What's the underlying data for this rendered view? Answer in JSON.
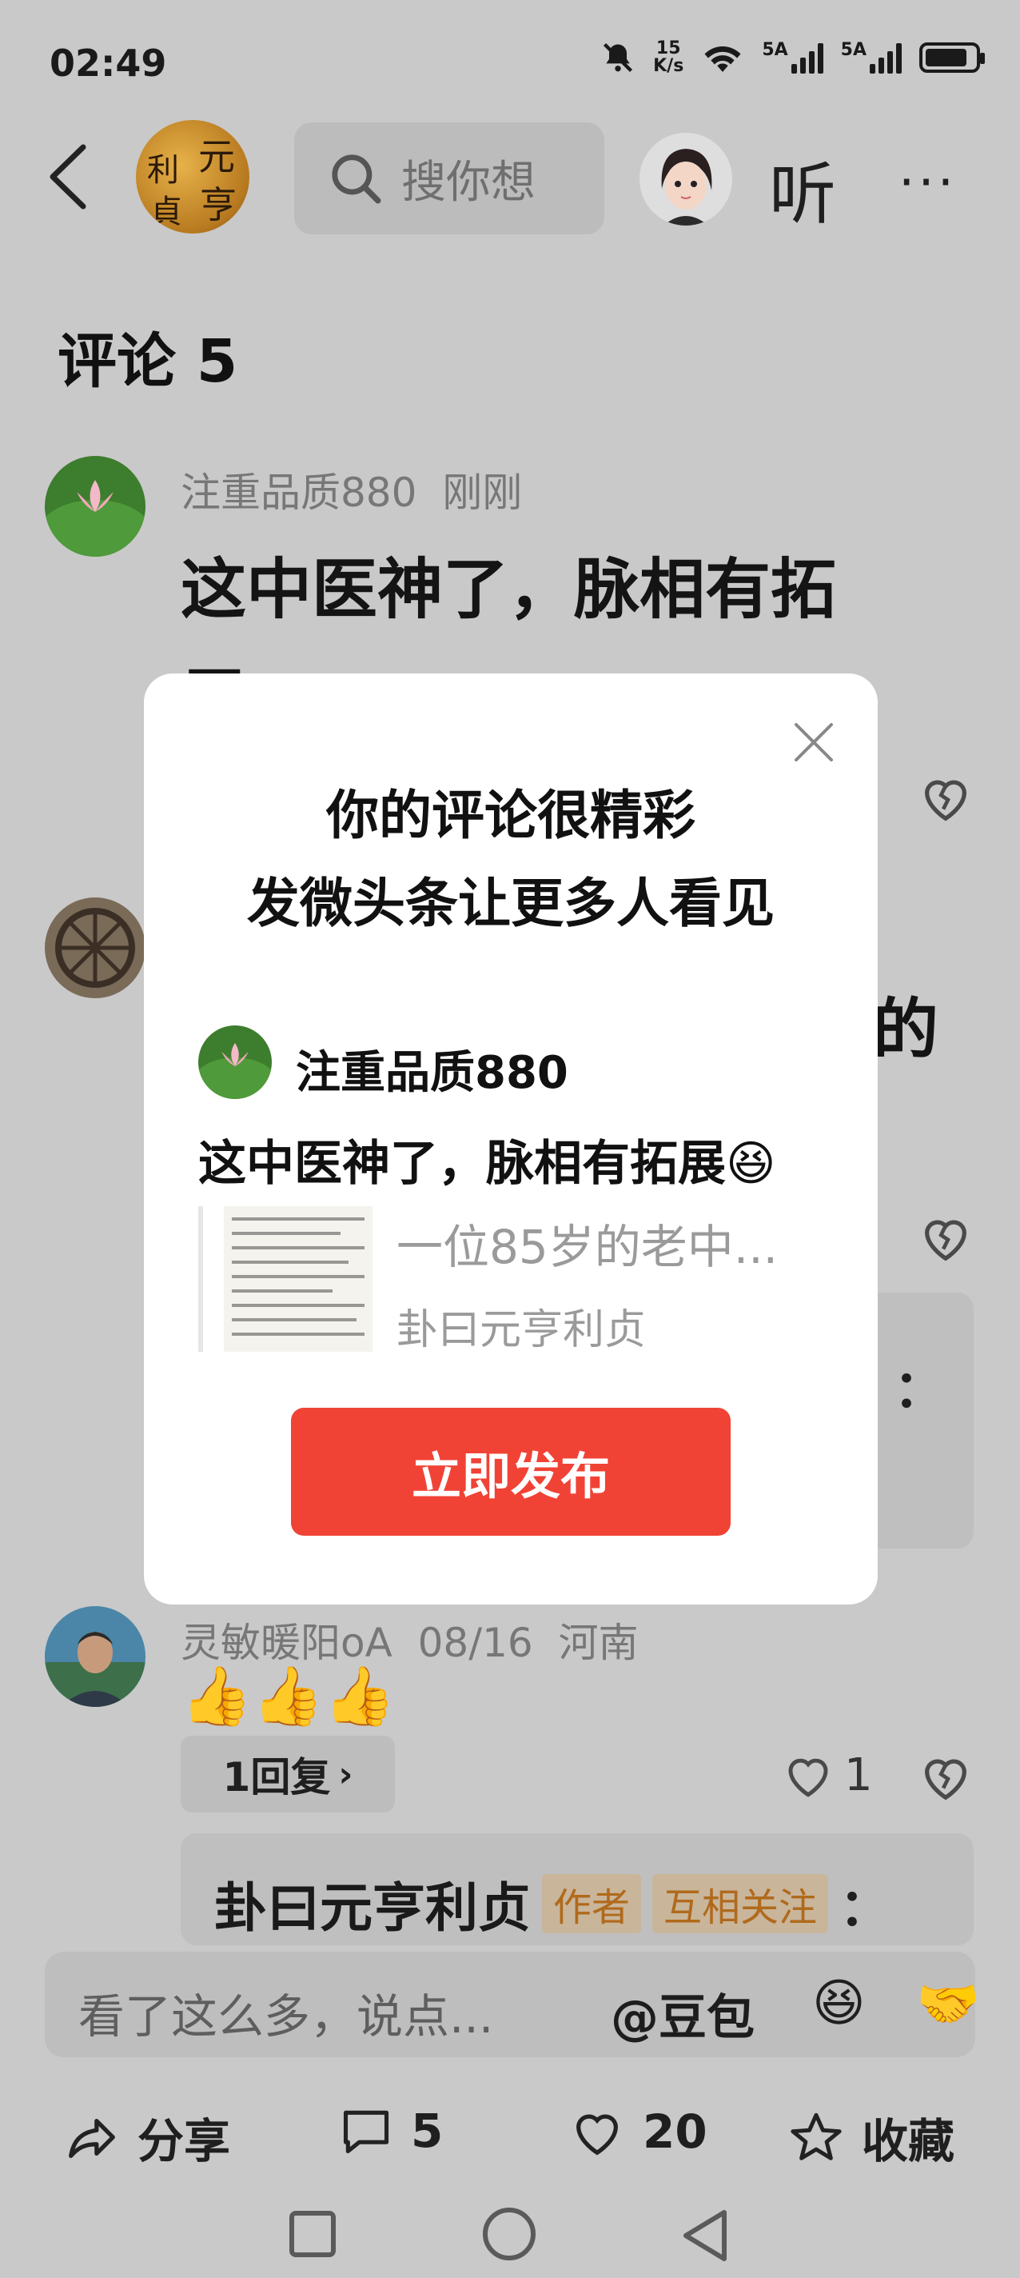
{
  "status_bar": {
    "time": "02:49",
    "net_speed_top": "15",
    "net_speed_bottom": "K/s",
    "sim1": "5A",
    "sim2": "5A",
    "battery_level": 0.85
  },
  "header": {
    "search_placeholder": "搜你想",
    "listen_label": "听",
    "more_label": "···",
    "author_avatar_glyphs": [
      "元",
      "亨",
      "利",
      "貞"
    ]
  },
  "comments_section": {
    "title": "评论 5",
    "comments": [
      {
        "user": "注重品质880",
        "time": "刚刚",
        "text": "这中医神了，脉相有拓",
        "text_cont": "展"
      },
      {
        "text_partial": "的"
      },
      {
        "user": "灵敏暖阳oA",
        "time": "08/16",
        "location": "河南",
        "text": "👍👍👍",
        "replies_label": "1回复",
        "likes": "1"
      }
    ],
    "author_reply_partial": "：",
    "author_reply": {
      "name": "卦曰元亨利贞",
      "tags": [
        "作者",
        "互相关注"
      ],
      "colon": "："
    }
  },
  "input_bar": {
    "placeholder": "看了这么多，说点...",
    "mention": "@豆包",
    "emoji_laugh": "😆",
    "emoji_handshake": "🤝"
  },
  "actions": {
    "share": "分享",
    "comments_count": "5",
    "likes_count": "20",
    "favorite": "收藏"
  },
  "modal": {
    "title_line1": "你的评论很精彩",
    "title_line2": "发微头条让更多人看见",
    "preview_user": "注重品质880",
    "preview_text": "这中医神了，脉相有拓展😆",
    "article_title": "一位85岁的老中...",
    "article_author": "卦曰元亨利贞",
    "publish_label": "立即发布"
  }
}
